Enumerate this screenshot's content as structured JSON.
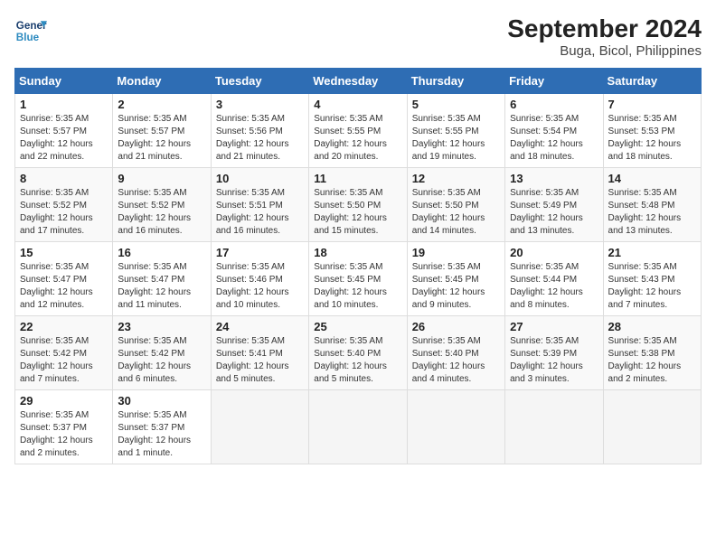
{
  "header": {
    "logo_line1": "General",
    "logo_line2": "Blue",
    "title": "September 2024",
    "subtitle": "Buga, Bicol, Philippines"
  },
  "days_of_week": [
    "Sunday",
    "Monday",
    "Tuesday",
    "Wednesday",
    "Thursday",
    "Friday",
    "Saturday"
  ],
  "weeks": [
    [
      {
        "day": "1",
        "lines": [
          "Sunrise: 5:35 AM",
          "Sunset: 5:57 PM",
          "Daylight: 12 hours",
          "and 22 minutes."
        ]
      },
      {
        "day": "2",
        "lines": [
          "Sunrise: 5:35 AM",
          "Sunset: 5:57 PM",
          "Daylight: 12 hours",
          "and 21 minutes."
        ]
      },
      {
        "day": "3",
        "lines": [
          "Sunrise: 5:35 AM",
          "Sunset: 5:56 PM",
          "Daylight: 12 hours",
          "and 21 minutes."
        ]
      },
      {
        "day": "4",
        "lines": [
          "Sunrise: 5:35 AM",
          "Sunset: 5:55 PM",
          "Daylight: 12 hours",
          "and 20 minutes."
        ]
      },
      {
        "day": "5",
        "lines": [
          "Sunrise: 5:35 AM",
          "Sunset: 5:55 PM",
          "Daylight: 12 hours",
          "and 19 minutes."
        ]
      },
      {
        "day": "6",
        "lines": [
          "Sunrise: 5:35 AM",
          "Sunset: 5:54 PM",
          "Daylight: 12 hours",
          "and 18 minutes."
        ]
      },
      {
        "day": "7",
        "lines": [
          "Sunrise: 5:35 AM",
          "Sunset: 5:53 PM",
          "Daylight: 12 hours",
          "and 18 minutes."
        ]
      }
    ],
    [
      {
        "day": "8",
        "lines": [
          "Sunrise: 5:35 AM",
          "Sunset: 5:52 PM",
          "Daylight: 12 hours",
          "and 17 minutes."
        ]
      },
      {
        "day": "9",
        "lines": [
          "Sunrise: 5:35 AM",
          "Sunset: 5:52 PM",
          "Daylight: 12 hours",
          "and 16 minutes."
        ]
      },
      {
        "day": "10",
        "lines": [
          "Sunrise: 5:35 AM",
          "Sunset: 5:51 PM",
          "Daylight: 12 hours",
          "and 16 minutes."
        ]
      },
      {
        "day": "11",
        "lines": [
          "Sunrise: 5:35 AM",
          "Sunset: 5:50 PM",
          "Daylight: 12 hours",
          "and 15 minutes."
        ]
      },
      {
        "day": "12",
        "lines": [
          "Sunrise: 5:35 AM",
          "Sunset: 5:50 PM",
          "Daylight: 12 hours",
          "and 14 minutes."
        ]
      },
      {
        "day": "13",
        "lines": [
          "Sunrise: 5:35 AM",
          "Sunset: 5:49 PM",
          "Daylight: 12 hours",
          "and 13 minutes."
        ]
      },
      {
        "day": "14",
        "lines": [
          "Sunrise: 5:35 AM",
          "Sunset: 5:48 PM",
          "Daylight: 12 hours",
          "and 13 minutes."
        ]
      }
    ],
    [
      {
        "day": "15",
        "lines": [
          "Sunrise: 5:35 AM",
          "Sunset: 5:47 PM",
          "Daylight: 12 hours",
          "and 12 minutes."
        ]
      },
      {
        "day": "16",
        "lines": [
          "Sunrise: 5:35 AM",
          "Sunset: 5:47 PM",
          "Daylight: 12 hours",
          "and 11 minutes."
        ]
      },
      {
        "day": "17",
        "lines": [
          "Sunrise: 5:35 AM",
          "Sunset: 5:46 PM",
          "Daylight: 12 hours",
          "and 10 minutes."
        ]
      },
      {
        "day": "18",
        "lines": [
          "Sunrise: 5:35 AM",
          "Sunset: 5:45 PM",
          "Daylight: 12 hours",
          "and 10 minutes."
        ]
      },
      {
        "day": "19",
        "lines": [
          "Sunrise: 5:35 AM",
          "Sunset: 5:45 PM",
          "Daylight: 12 hours",
          "and 9 minutes."
        ]
      },
      {
        "day": "20",
        "lines": [
          "Sunrise: 5:35 AM",
          "Sunset: 5:44 PM",
          "Daylight: 12 hours",
          "and 8 minutes."
        ]
      },
      {
        "day": "21",
        "lines": [
          "Sunrise: 5:35 AM",
          "Sunset: 5:43 PM",
          "Daylight: 12 hours",
          "and 7 minutes."
        ]
      }
    ],
    [
      {
        "day": "22",
        "lines": [
          "Sunrise: 5:35 AM",
          "Sunset: 5:42 PM",
          "Daylight: 12 hours",
          "and 7 minutes."
        ]
      },
      {
        "day": "23",
        "lines": [
          "Sunrise: 5:35 AM",
          "Sunset: 5:42 PM",
          "Daylight: 12 hours",
          "and 6 minutes."
        ]
      },
      {
        "day": "24",
        "lines": [
          "Sunrise: 5:35 AM",
          "Sunset: 5:41 PM",
          "Daylight: 12 hours",
          "and 5 minutes."
        ]
      },
      {
        "day": "25",
        "lines": [
          "Sunrise: 5:35 AM",
          "Sunset: 5:40 PM",
          "Daylight: 12 hours",
          "and 5 minutes."
        ]
      },
      {
        "day": "26",
        "lines": [
          "Sunrise: 5:35 AM",
          "Sunset: 5:40 PM",
          "Daylight: 12 hours",
          "and 4 minutes."
        ]
      },
      {
        "day": "27",
        "lines": [
          "Sunrise: 5:35 AM",
          "Sunset: 5:39 PM",
          "Daylight: 12 hours",
          "and 3 minutes."
        ]
      },
      {
        "day": "28",
        "lines": [
          "Sunrise: 5:35 AM",
          "Sunset: 5:38 PM",
          "Daylight: 12 hours",
          "and 2 minutes."
        ]
      }
    ],
    [
      {
        "day": "29",
        "lines": [
          "Sunrise: 5:35 AM",
          "Sunset: 5:37 PM",
          "Daylight: 12 hours",
          "and 2 minutes."
        ]
      },
      {
        "day": "30",
        "lines": [
          "Sunrise: 5:35 AM",
          "Sunset: 5:37 PM",
          "Daylight: 12 hours",
          "and 1 minute."
        ]
      },
      {
        "day": "",
        "lines": []
      },
      {
        "day": "",
        "lines": []
      },
      {
        "day": "",
        "lines": []
      },
      {
        "day": "",
        "lines": []
      },
      {
        "day": "",
        "lines": []
      }
    ]
  ]
}
